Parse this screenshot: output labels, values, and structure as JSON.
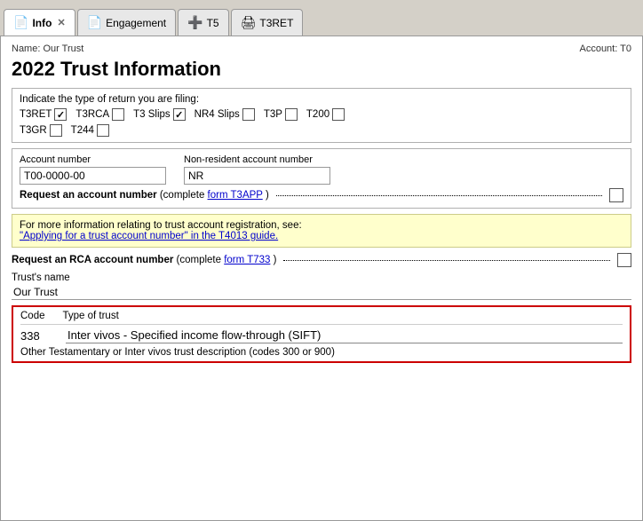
{
  "tabs": [
    {
      "id": "info",
      "label": "Info",
      "icon": "📄",
      "active": true,
      "closable": true
    },
    {
      "id": "engagement",
      "label": "Engagement",
      "icon": "📄",
      "active": false,
      "closable": false
    },
    {
      "id": "t5",
      "label": "T5",
      "icon": "➕",
      "active": false,
      "closable": false
    },
    {
      "id": "t3ret",
      "label": "T3RET",
      "icon": "🖨",
      "active": false,
      "closable": false
    }
  ],
  "header": {
    "name_label": "Name:",
    "name_value": "Our Trust",
    "account_label": "Account:",
    "account_value": "T0"
  },
  "page_title": "2022 Trust Information",
  "return_type": {
    "label": "Indicate the type of return you are filing:",
    "checkboxes": [
      {
        "id": "t3ret",
        "label": "T3RET",
        "checked": true
      },
      {
        "id": "t3rca",
        "label": "T3RCA",
        "checked": false
      },
      {
        "id": "t3slips",
        "label": "T3 Slips",
        "checked": true
      },
      {
        "id": "nr4slips",
        "label": "NR4 Slips",
        "checked": false
      },
      {
        "id": "t3p",
        "label": "T3P",
        "checked": false
      },
      {
        "id": "t200",
        "label": "T200",
        "checked": false
      },
      {
        "id": "t3gr",
        "label": "T3GR",
        "checked": false
      },
      {
        "id": "t244",
        "label": "T244",
        "checked": false
      }
    ]
  },
  "account_number": {
    "label": "Account number",
    "value": "T00-0000-00"
  },
  "non_resident_account": {
    "label": "Non-resident account number",
    "value": "NR"
  },
  "request_account": {
    "text_bold": "Request an account number",
    "text_normal": " (complete ",
    "link_text": "form T3APP",
    "text_end": " ) "
  },
  "info_box": {
    "line1": "For more information relating to trust account registration, see:",
    "link_text": "\"Applying for a trust account number\" in the T4013 guide."
  },
  "request_rca": {
    "text_bold": "Request an RCA account number",
    "text_normal": " (complete ",
    "link_text": "form T733",
    "text_end": " ) "
  },
  "trust_name": {
    "label": "Trust's name",
    "value": "Our Trust"
  },
  "trust_code": {
    "col_code": "Code",
    "col_type": "Type of trust",
    "code_value": "338",
    "type_value": "Inter vivos - Specified income flow-through (SIFT)",
    "description": "Other Testamentary or Inter vivos trust description (codes 300 or 900)"
  }
}
